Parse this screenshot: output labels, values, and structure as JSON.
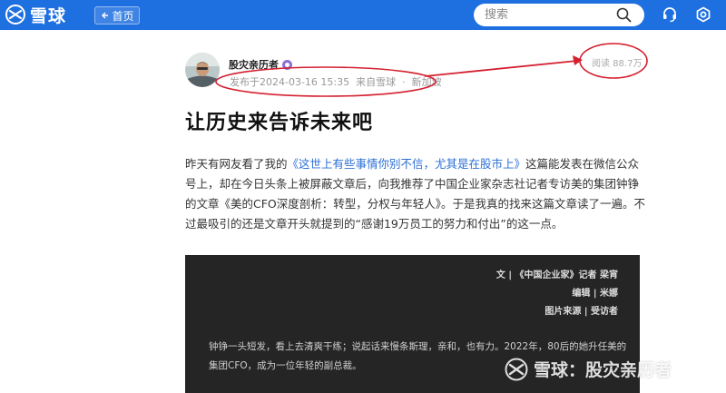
{
  "brand": {
    "name": "雪球",
    "accent": "#1e6fe0"
  },
  "nav": {
    "home_label": "首页"
  },
  "search": {
    "placeholder": "搜索"
  },
  "icons": {
    "search": "search-icon",
    "support": "headset-icon",
    "settings": "gear-icon",
    "back": "back-arrow-icon"
  },
  "post": {
    "author": "股灾亲历者",
    "published": "发布于2024-03-16 15:35",
    "source": "来自雪球",
    "separator": "·",
    "location": "新加坡",
    "reads": "阅读 88.7万",
    "title": "让历史来告诉未来吧",
    "body": {
      "p1_start": "昨天有网友看了我的",
      "p1_link": "《这世上有些事情你别不信，尤其是在股市上》",
      "p1_rest": "这篇能发表在微信公众号上，却在今日头条上被屏蔽文章后，向我推荐了中国企业家杂志社记者专访美的集团钟铮的文章《美的CFO深度剖析：转型，分权与年轻人》。于是我真的找来这篇文章读了一遍。不过最吸引的还是文章开头就提到的“感谢19万员工的努力和付出”的这一点。"
    },
    "photo": {
      "credit_line1": "文 | 《中国企业家》记者 梁宵",
      "credit_line2": "编辑 | 米娜",
      "credit_line3": "图片来源 | 受访者",
      "caption": "钟铮一头短发，看上去清爽干练；说起话来慢条斯理，亲和，也有力。2022年，80后的她升任美的集团CFO，成为一位年轻的副总裁。"
    }
  },
  "watermark": {
    "text": "雪球：股灾亲历者"
  },
  "annotation_color": "#d42030"
}
